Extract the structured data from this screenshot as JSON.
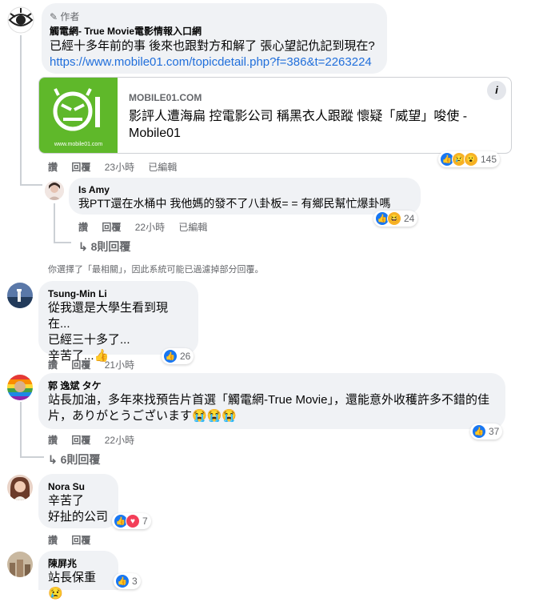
{
  "comments": [
    {
      "author_badge": "作者",
      "author": "觸電網- True Movie電影情報入口網",
      "text": "已經十多年前的事 後來也跟對方和解了 張心望記仇記到現在?",
      "link": "https://www.mobile01.com/topicdetail.php?f=386&t=2263224",
      "preview": {
        "domain": "MOBILE01.COM",
        "title": "影評人遭海扁 控電影公司 稱黑衣人跟蹤 懷疑「威望」唆使 - Mobile01",
        "logo_caption": "www.mobile01.com",
        "info": "i"
      },
      "actions": [
        "讚",
        "回覆",
        "23小時",
        "已編輯"
      ],
      "reactions": [
        "like",
        "sad",
        "wow"
      ],
      "reaction_count": "145"
    },
    {
      "author": "Is Amy",
      "text": "我PTT還在水桶中 我他媽的發不了八卦板= = 有鄉民幫忙爆卦嗎",
      "actions": [
        "讚",
        "回覆",
        "22小時",
        "已編輯"
      ],
      "reactions": [
        "like",
        "haha"
      ],
      "reaction_count": "24"
    },
    {
      "author": "Tsung-Min Li",
      "text": "從我還是大學生看到現在...\n已經三十多了...\n辛苦了...👍",
      "actions": [
        "讚",
        "回覆",
        "21小時"
      ],
      "reactions": [
        "like"
      ],
      "reaction_count": "26"
    },
    {
      "author": "郭 逸斌 タケ",
      "text": "站長加油，多年來找預告片首選「觸電網-True Movie」，還能意外收穫許多不錯的佳片，ありがとうございます😭😭😭",
      "actions": [
        "讚",
        "回覆",
        "22小時"
      ],
      "reactions": [
        "like"
      ],
      "reaction_count": "37"
    },
    {
      "author": "Nora Su",
      "text": "辛苦了\n好扯的公司",
      "reactions": [
        "like",
        "heart"
      ],
      "reaction_count": "7"
    },
    {
      "author": "陳屏兆",
      "text": "站長保重😢",
      "reactions": [
        "like"
      ],
      "reaction_count": "3"
    }
  ],
  "view_replies": [
    "8則回覆",
    "6則回覆"
  ],
  "filter_notice": "你選擇了「最相關」，因此系統可能已過濾掉部分回覆。",
  "colors": {
    "accent": "#1877f2",
    "bubble": "#f0f2f5",
    "link": "#216fdb",
    "logo_green": "#5fb82a"
  }
}
